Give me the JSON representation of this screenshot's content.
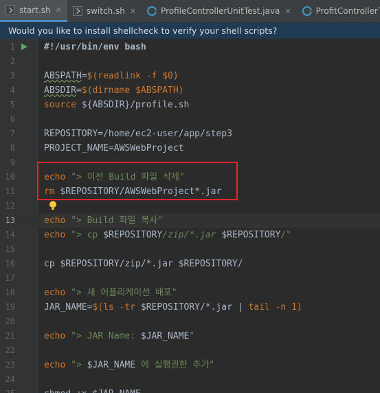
{
  "tabs": [
    {
      "label": "start.sh",
      "icon": "shell-script-icon",
      "active": true
    },
    {
      "label": "switch.sh",
      "icon": "shell-script-icon",
      "active": false
    },
    {
      "label": "ProfileControllerUnitTest.java",
      "icon": "java-class-icon",
      "active": false
    },
    {
      "label": "ProfitControllerTest.java",
      "icon": "java-class-icon",
      "active": false
    }
  ],
  "close_glyph": "✕",
  "banner": {
    "text": "Would you like to install shellcheck to verify your shell scripts?"
  },
  "colors": {
    "keyword": "#cc7832",
    "string": "#6a8759",
    "text": "#a9b7c6",
    "highlight_box": "#e0262b",
    "banner_bg": "#1f3b53"
  },
  "current_line": 13,
  "lines": [
    {
      "n": "1",
      "t": [
        [
          "#!/usr/bin/env bash",
          "shebang"
        ]
      ]
    },
    {
      "n": "2",
      "t": []
    },
    {
      "n": "3",
      "t": [
        [
          "ABSPATH",
          "wavy"
        ],
        [
          "=",
          ""
        ],
        [
          "$(readlink -f $0)",
          "kw"
        ]
      ]
    },
    {
      "n": "4",
      "t": [
        [
          "ABSDIR",
          "wavy"
        ],
        [
          "=",
          ""
        ],
        [
          "$(dirname $ABSPATH)",
          "kw"
        ]
      ]
    },
    {
      "n": "5",
      "t": [
        [
          "source",
          "kw"
        ],
        [
          " ${ABSDIR}/profile.sh",
          ""
        ]
      ]
    },
    {
      "n": "6",
      "t": []
    },
    {
      "n": "7",
      "t": [
        [
          "REPOSITORY=/home/ec2-user/app/step3",
          ""
        ]
      ]
    },
    {
      "n": "8",
      "t": [
        [
          "PROJECT_NAME=AWSWebProject",
          ""
        ]
      ]
    },
    {
      "n": "9",
      "t": []
    },
    {
      "n": "10",
      "t": [
        [
          "echo",
          "kw"
        ],
        [
          " \"> 이전 Build 파일 삭제\"",
          "str"
        ]
      ]
    },
    {
      "n": "11",
      "t": [
        [
          "rm",
          "kw"
        ],
        [
          " $REPOSITORY/AWSWebProject*.jar",
          ""
        ]
      ]
    },
    {
      "n": "12",
      "t": []
    },
    {
      "n": "13",
      "t": [
        [
          "echo",
          "kw"
        ],
        [
          " \"> Build 파일 복사\"",
          "str"
        ]
      ]
    },
    {
      "n": "14",
      "t": [
        [
          "echo",
          "kw"
        ],
        [
          " \"> cp ",
          "str"
        ],
        [
          "$REPOSITORY",
          "plain"
        ],
        [
          "/zip/*.jar ",
          "stri"
        ],
        [
          "$REPOSITORY",
          "plain"
        ],
        [
          "/\"",
          "str"
        ]
      ]
    },
    {
      "n": "15",
      "t": []
    },
    {
      "n": "16",
      "t": [
        [
          "cp $REPOSITORY/zip/*.jar $REPOSITORY/",
          ""
        ]
      ]
    },
    {
      "n": "17",
      "t": []
    },
    {
      "n": "18",
      "t": [
        [
          "echo",
          "kw"
        ],
        [
          " \"> 새 어플리케이션 배포\"",
          "str"
        ]
      ]
    },
    {
      "n": "19",
      "t": [
        [
          "JAR_NAME=",
          ""
        ],
        [
          "$(ls -tr ",
          "kw"
        ],
        [
          "$REPOSITORY",
          "plain"
        ],
        [
          "/*.jar | ",
          "plain"
        ],
        [
          "tail",
          "kw"
        ],
        [
          " -n 1)",
          "kw"
        ]
      ]
    },
    {
      "n": "20",
      "t": []
    },
    {
      "n": "21",
      "t": [
        [
          "echo",
          "kw"
        ],
        [
          " \"> JAR Name: ",
          "str"
        ],
        [
          "$JAR_NAME",
          "plain"
        ],
        [
          "\"",
          "str"
        ]
      ]
    },
    {
      "n": "22",
      "t": []
    },
    {
      "n": "23",
      "t": [
        [
          "echo",
          "kw"
        ],
        [
          " \"> ",
          "str"
        ],
        [
          "$JAR_NAME",
          "plain"
        ],
        [
          " 에 실행권한 추가\"",
          "str"
        ]
      ]
    },
    {
      "n": "24",
      "t": []
    },
    {
      "n": "25",
      "t": [
        [
          "chmod +x $JAR_NAME",
          ""
        ]
      ]
    }
  ]
}
